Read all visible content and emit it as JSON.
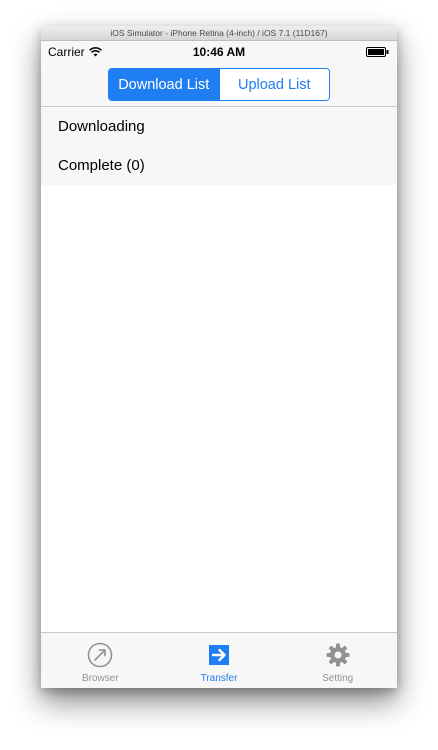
{
  "simulator": {
    "title": "iOS Simulator - iPhone Retina (4-inch) / iOS 7.1 (11D167)"
  },
  "status_bar": {
    "carrier": "Carrier",
    "time": "10:46 AM",
    "icons": [
      "wifi-icon",
      "battery-icon"
    ]
  },
  "segmented": {
    "items": [
      {
        "label": "Download List",
        "selected": true
      },
      {
        "label": "Upload List",
        "selected": false
      }
    ]
  },
  "list": {
    "items": [
      {
        "label": "Downloading"
      },
      {
        "label": "Complete (0)"
      }
    ]
  },
  "tab_bar": {
    "items": [
      {
        "label": "Browser",
        "icon": "compass-icon",
        "selected": false
      },
      {
        "label": "Transfer",
        "icon": "transfer-arrow-icon",
        "selected": true
      },
      {
        "label": "Setting",
        "icon": "gear-icon",
        "selected": false
      }
    ]
  },
  "colors": {
    "accent": "#1f7ef2",
    "inactive": "#929292",
    "bar_background": "#f7f7f7"
  }
}
